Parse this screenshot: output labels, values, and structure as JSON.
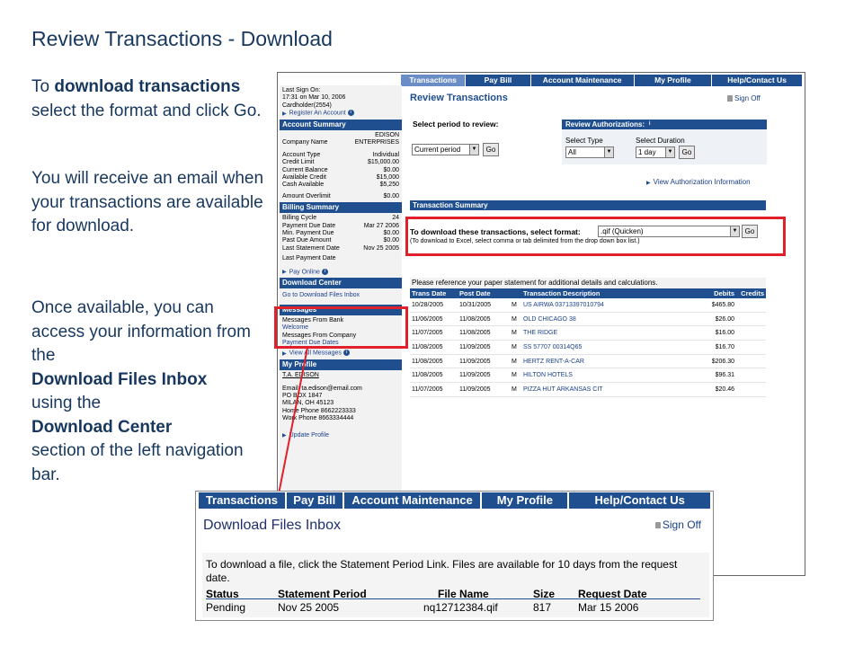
{
  "slide": {
    "title": "Review Transactions - Download",
    "p1_pre": "To ",
    "p1_bold": "download transactions",
    "p1_post": " select the format and click Go.",
    "p2": "You will receive an email when your transactions are available for download.",
    "p3_pre": "Once available, you can access your information from the",
    "p3_bold1": "Download Files Inbox",
    "p3_mid": "using the",
    "p3_bold2": "Download Center",
    "p3_post": "section of the left navigation bar."
  },
  "main": {
    "tabs": [
      "Transactions",
      "Pay Bill",
      "Account Maintenance",
      "My Profile",
      "Help/Contact Us"
    ],
    "sidebar": {
      "last_sign_on_label": "Last Sign On:",
      "last_sign_on_value": "17:31 on Mar 10, 2006",
      "cardholder": "Cardholder(2554)",
      "register_link": "Register An Account",
      "account_summary_title": "Account Summary",
      "company_top": "EDISON",
      "company_label": "Company Name",
      "company_value": "ENTERPRISES",
      "account_rows": [
        {
          "label": "Account Type",
          "value": "Individual"
        },
        {
          "label": "Credit Limit",
          "value": "$15,000.00"
        },
        {
          "label": "Current Balance",
          "value": "$0.00"
        },
        {
          "label": "Available Credit",
          "value": "$15,000"
        },
        {
          "label": "Cash Available",
          "value": "$5,250"
        }
      ],
      "overlimit_label": "Amount Overlimit",
      "overlimit_value": "$0.00",
      "billing_title": "Billing Summary",
      "billing_rows": [
        {
          "label": "Billing Cycle",
          "value": "24"
        },
        {
          "label": "Payment Due Date",
          "value": "Mar 27 2006"
        },
        {
          "label": "Min. Payment Due",
          "value": "$0.00"
        },
        {
          "label": "Past Due Amount",
          "value": "$0.00"
        },
        {
          "label": "Last Statement Date",
          "value": "Nov 25 2005"
        }
      ],
      "last_payment_label": "Last Payment Date",
      "pay_online": "Pay Online",
      "download_center_title": "Download Center",
      "download_link": "Go to Download Files Inbox",
      "messages_title": "Messages",
      "messages_from_bank": "Messages From Bank",
      "welcome": "Welcome",
      "messages_from_company": "Messages From Company",
      "payment_due_dates": "Payment Due Dates",
      "view_all_messages": "View All Messages",
      "my_profile_title": "My Profile",
      "profile_name": "T.A. EDISON",
      "profile_lines": [
        "Email: ta.edison@email.com",
        "PO BOX 1847",
        "MILAN, OH 45123",
        "Home Phone 8662223333",
        "Work Phone 8663334444"
      ],
      "update_profile": "Update Profile"
    },
    "content": {
      "title": "Review Transactions",
      "sign_off": "Sign Off",
      "select_period_label": "Select period to review:",
      "period_value": "Current period",
      "go": "Go",
      "review_auth_title": "Review Authorizations:",
      "select_type_label": "Select Type",
      "select_type_value": "All",
      "select_duration_label": "Select Duration",
      "select_duration_value": "1 day",
      "view_auth_link": "View Authorization Information",
      "summary_title": "Transaction Summary",
      "download_label": "To download these transactions, select format:",
      "download_format": ".qif (Quicken)",
      "download_note": "(To download to Excel, select comma or tab delimited from the drop down box list.)",
      "txn_note": "Please reference your paper statement for additional details and calculations.",
      "txn_headers": {
        "trans_date": "Trans Date",
        "post_date": "Post Date",
        "desc": "Transaction Description",
        "debits": "Debits",
        "credits": "Credits"
      },
      "transactions": [
        {
          "trans_date": "10/28/2005",
          "post_date": "10/31/2005",
          "m": "M",
          "desc": "US AIRWA 03713397010794",
          "debit": "$465.80"
        },
        {
          "trans_date": "11/06/2005",
          "post_date": "11/08/2005",
          "m": "M",
          "desc": "OLD CHICAGO 38",
          "debit": "$26.00"
        },
        {
          "trans_date": "11/07/2005",
          "post_date": "11/08/2005",
          "m": "M",
          "desc": "THE RIDGE",
          "debit": "$16.00"
        },
        {
          "trans_date": "11/08/2005",
          "post_date": "11/09/2005",
          "m": "M",
          "desc": "SS 57707 00314Q65",
          "debit": "$16.70"
        },
        {
          "trans_date": "11/08/2005",
          "post_date": "11/09/2005",
          "m": "M",
          "desc": "HERTZ RENT-A-CAR",
          "debit": "$206.30"
        },
        {
          "trans_date": "11/08/2005",
          "post_date": "11/09/2005",
          "m": "M",
          "desc": "HILTON HOTELS",
          "debit": "$96.31"
        },
        {
          "trans_date": "11/07/2005",
          "post_date": "11/09/2005",
          "m": "M",
          "desc": "PIZZA HUT ARKANSAS CIT",
          "debit": "$20.46"
        }
      ]
    }
  },
  "inbox": {
    "tabs": [
      "Transactions",
      "Pay Bill",
      "Account Maintenance",
      "My Profile",
      "Help/Contact Us"
    ],
    "title": "Download Files Inbox",
    "sign_off": "Sign Off",
    "instructions": "To download a file, click the Statement Period Link. Files are available for 10 days from the request date.",
    "headers": {
      "status": "Status",
      "period": "Statement Period",
      "file": "File Name",
      "size": "Size",
      "date": "Request Date"
    },
    "row": {
      "status": "Pending",
      "period": "Nov 25 2005",
      "file": "nq12712384.qif",
      "size": "817",
      "date": "Mar 15 2006"
    }
  },
  "colors": {
    "nav_blue": "#1f4f8f",
    "highlight_red": "#e0202a",
    "slide_text": "#17375e"
  }
}
